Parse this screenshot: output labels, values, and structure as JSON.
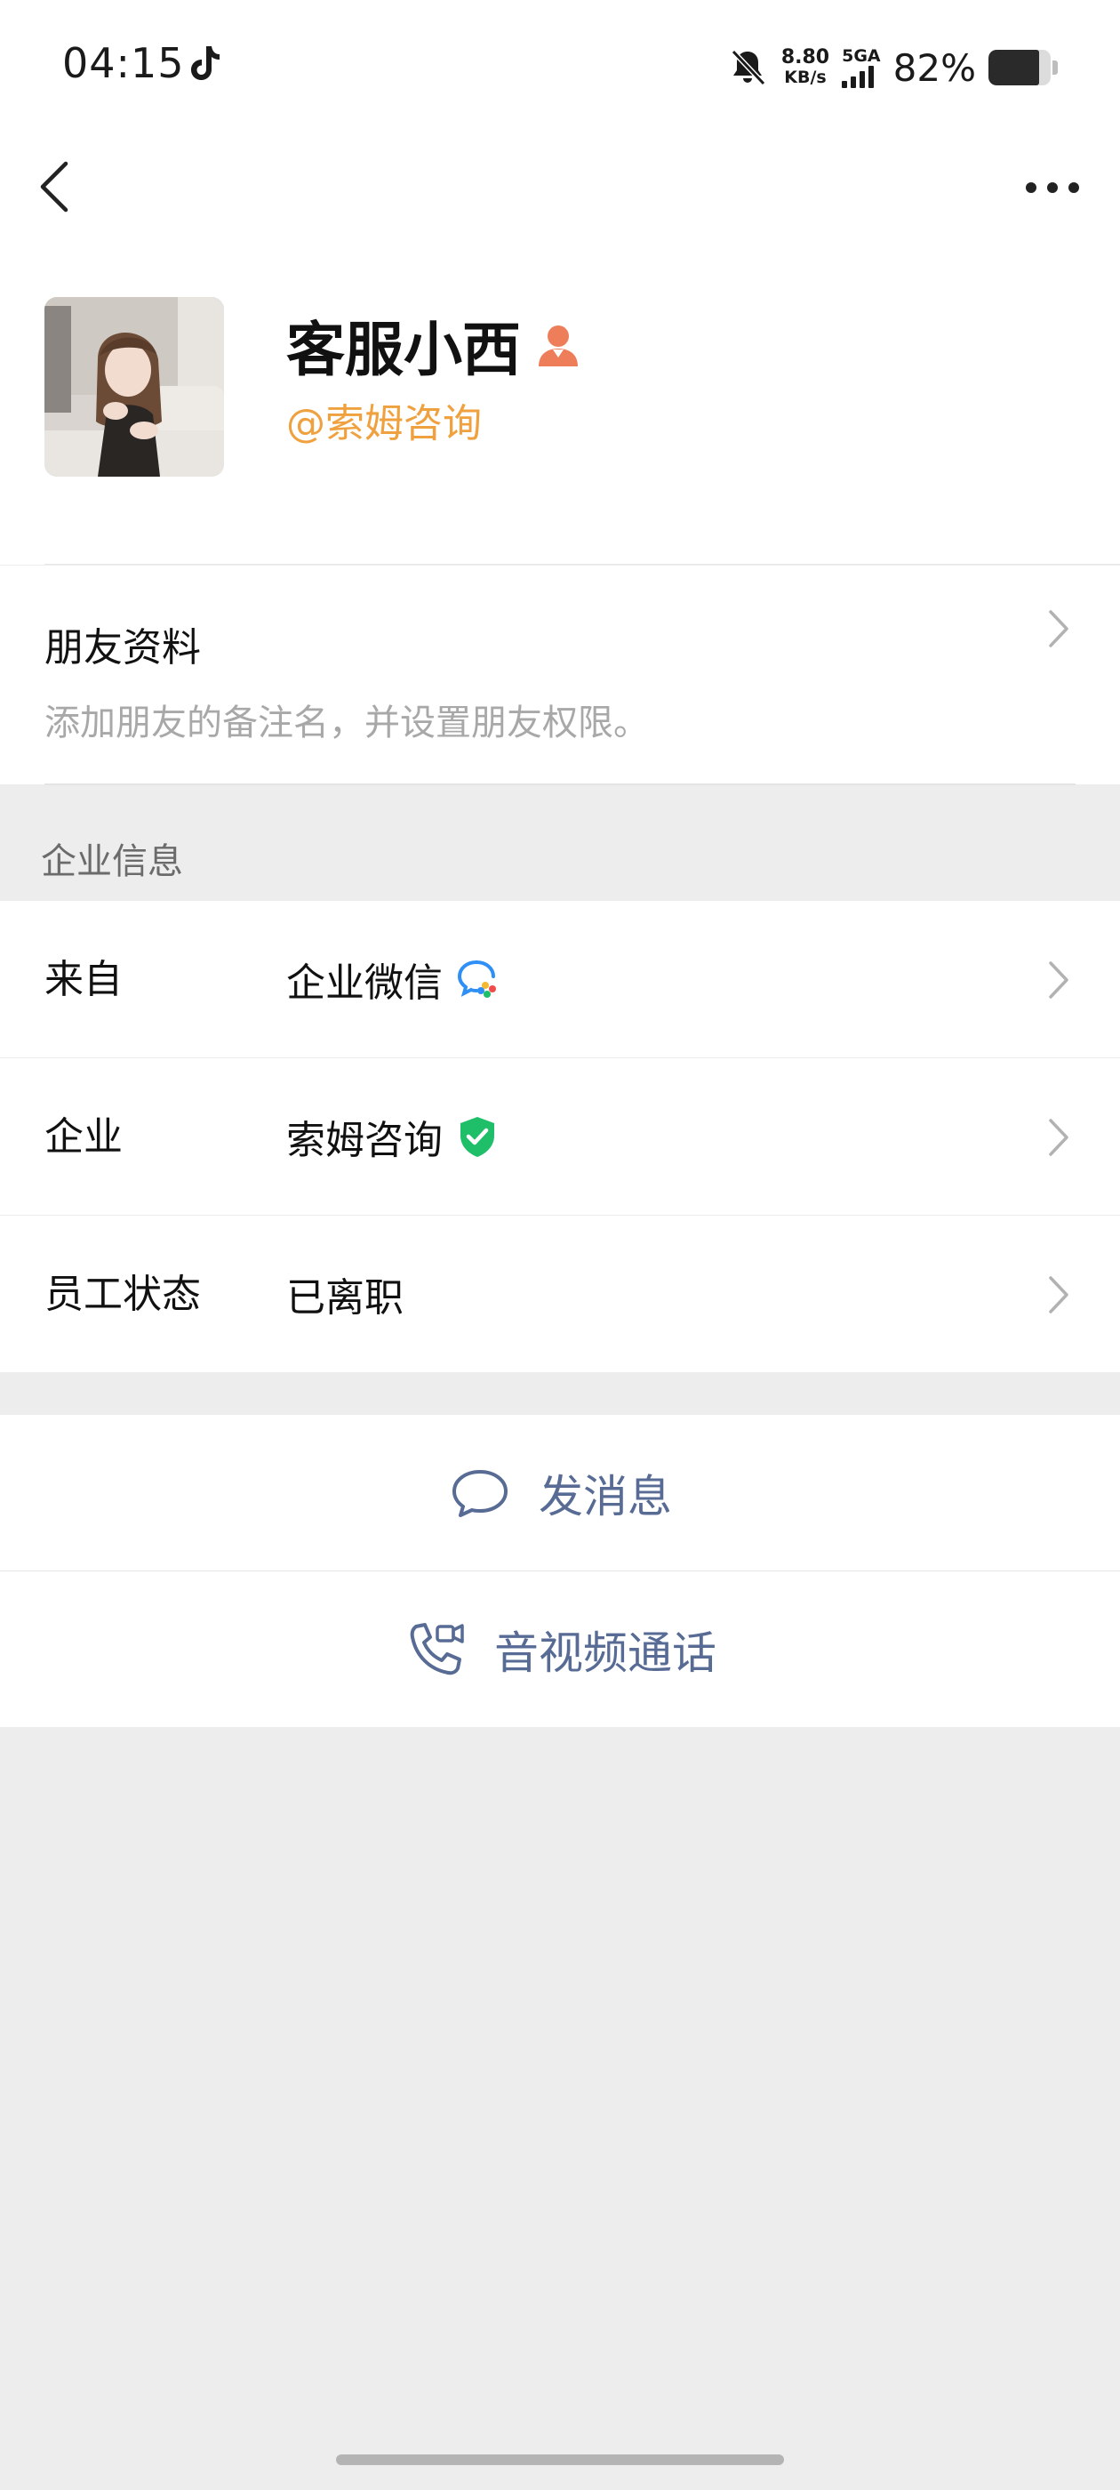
{
  "status_bar": {
    "time": "04:15",
    "app_icon": "tiktok-icon",
    "mute_icon": "bell-off-icon",
    "net_speed_value": "8.80",
    "net_speed_unit": "KB/s",
    "network_type": "5GA",
    "signal_bars": 4,
    "battery_percent": "82%",
    "battery_level": 0.82
  },
  "nav": {
    "back_icon": "chevron-left-icon",
    "more_icon": "more-dots-icon"
  },
  "profile": {
    "name": "客服小西",
    "badge_icon": "staff-person-icon",
    "company_handle": "@索姆咨询",
    "handle_color": "#f0a13f"
  },
  "friend_profile": {
    "title": "朋友资料",
    "description": "添加朋友的备注名，并设置朋友权限。"
  },
  "enterprise": {
    "section_label": "企业信息",
    "rows": [
      {
        "label": "来自",
        "value": "企业微信",
        "icon": "wecom-logo-icon"
      },
      {
        "label": "企业",
        "value": "索姆咨询",
        "icon": "verified-shield-icon"
      },
      {
        "label": "员工状态",
        "value": "已离职",
        "icon": ""
      }
    ]
  },
  "actions": {
    "message": {
      "label": "发消息",
      "icon": "chat-bubble-icon"
    },
    "call": {
      "label": "音视频通话",
      "icon": "phone-video-icon"
    },
    "accent_color": "#576b95"
  }
}
